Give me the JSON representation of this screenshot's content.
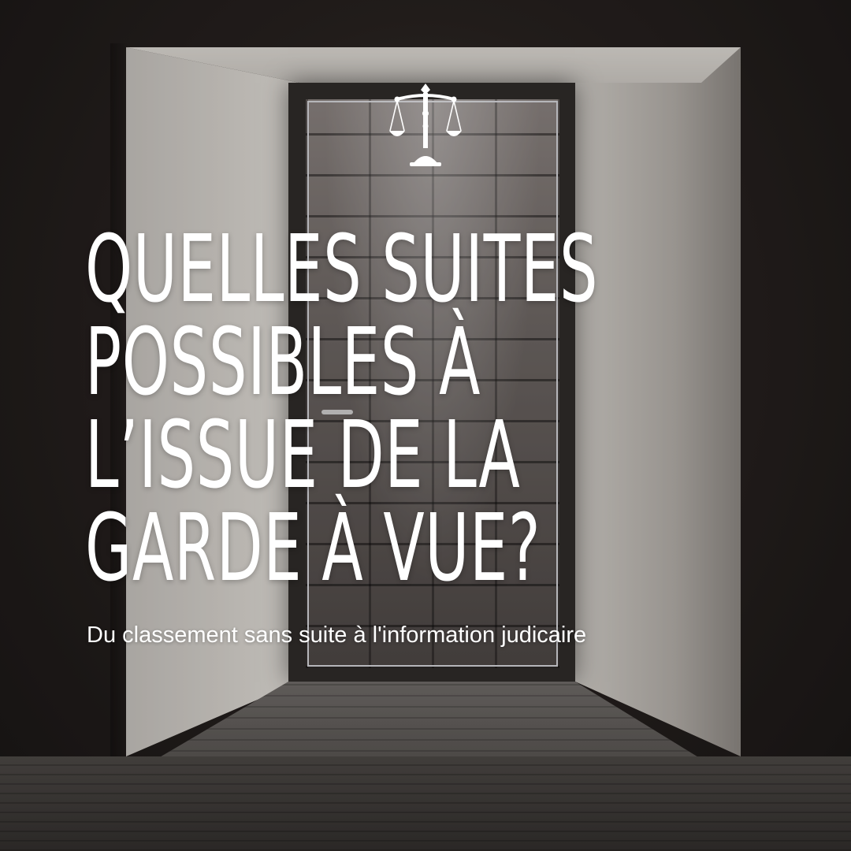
{
  "headline": {
    "lines": [
      "QUELLES SUITES",
      "POSSIBLES À",
      "L’ISSUE DE LA",
      "GARDE À VUE?"
    ]
  },
  "subtitle": "Du classement sans suite à l'information judicaire",
  "icons": {
    "emblem": "scales-of-justice-icon"
  },
  "colors": {
    "text": "#ffffff",
    "wall": "#d9d6d0",
    "background": "#1a1918"
  }
}
